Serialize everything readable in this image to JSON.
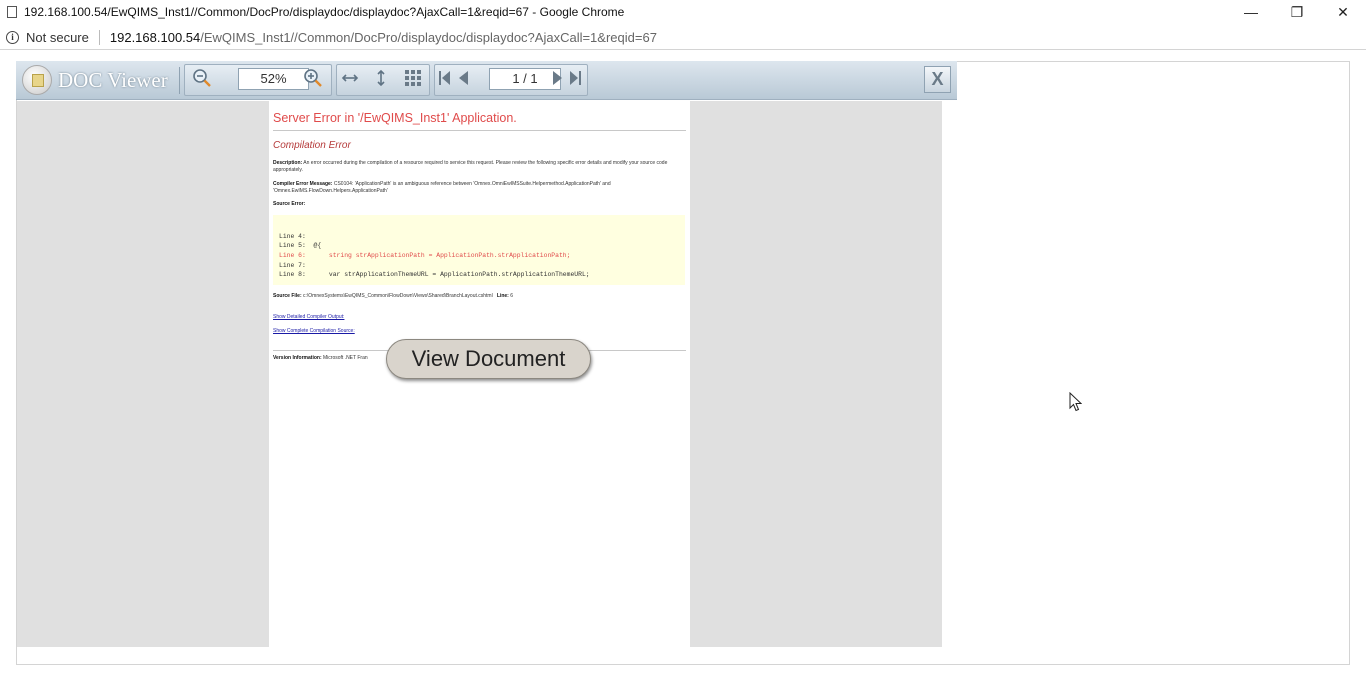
{
  "window": {
    "title": "192.168.100.54/EwQIMS_Inst1//Common/DocPro/displaydoc/displaydoc?AjaxCall=1&reqid=67 - Google Chrome",
    "minimize_glyph": "—",
    "maximize_glyph": "❐",
    "close_glyph": "✕"
  },
  "addressbar": {
    "security_label": "Not secure",
    "url_host": "192.168.100.54",
    "url_path": "/EwQIMS_Inst1//Common/DocPro/displaydoc/displaydoc?AjaxCall=1&reqid=67"
  },
  "viewer": {
    "app_title": "DOC Viewer",
    "zoom_value": "52%",
    "page_value": "1 / 1",
    "close_label": "X",
    "view_document_label": "View Document"
  },
  "document": {
    "error_title": "Server Error in '/EwQIMS_Inst1' Application.",
    "error_subtitle": "Compilation Error",
    "description_label": "Description:",
    "description_text": "An error occurred during the compilation of a resource required to service this request. Please review the following specific error details and modify your source code appropriately.",
    "compiler_message_label": "Compiler Error Message:",
    "compiler_message_text": "CS0104: 'ApplicationPath' is an ambiguous reference between 'Omnex.OmniEwIMSSuite.Helpermethod.ApplicationPath' and 'Omnex.EwIMS.FlowDown.Helpers.ApplicationPath'",
    "source_error_label": "Source Error:",
    "code_lines": [
      {
        "text": "Line 4:",
        "red": false
      },
      {
        "text": "Line 5:  @{",
        "red": false
      },
      {
        "text": "Line 6:      string strApplicationPath = ApplicationPath.strApplicationPath;",
        "red": true
      },
      {
        "text": "Line 7:",
        "red": false
      },
      {
        "text": "Line 8:      var strApplicationThemeURL = ApplicationPath.strApplicationThemeURL;",
        "red": false
      }
    ],
    "source_file_label": "Source File:",
    "source_file_text": "c:\\OmnexSystems\\EwQIMS_Common\\FlowDown\\Views\\Shared\\BranchLayout.cshtml",
    "line_label": "Line:",
    "line_value": "6",
    "link_detailed": "Show Detailed Compiler Output:",
    "link_complete": "Show Complete Compilation Source:",
    "version_label": "Version Information:",
    "version_text": "Microsoft .NET Fran"
  },
  "icons": {
    "zoom_out": "zoom-out-icon",
    "zoom_in": "zoom-in-icon",
    "fit_width": "fit-width-icon",
    "fit_height": "fit-height-icon",
    "thumbnails": "grid-icon",
    "first": "first-page-icon",
    "prev": "prev-page-icon",
    "next": "next-page-icon",
    "last": "last-page-icon"
  }
}
